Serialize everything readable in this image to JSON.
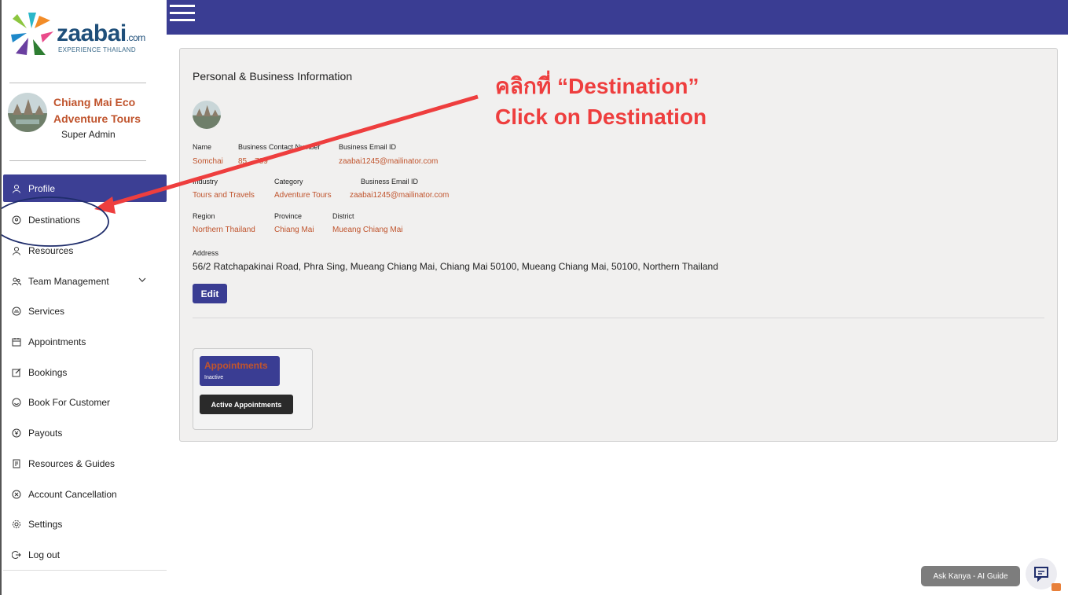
{
  "brand": {
    "name": "zaabai",
    "domain": ".com",
    "tagline": "EXPERIENCE THAILAND"
  },
  "account": {
    "business_name_line1": "Chiang Mai Eco",
    "business_name_line2": "Adventure Tours",
    "role": "Super Admin"
  },
  "sidebar": {
    "items": [
      {
        "label": "Profile",
        "icon": "user-icon"
      },
      {
        "label": "Destinations",
        "icon": "location-pin-icon"
      },
      {
        "label": "Resources",
        "icon": "user-icon"
      },
      {
        "label": "Team Management",
        "icon": "team-icon"
      },
      {
        "label": "Services",
        "icon": "services-icon"
      },
      {
        "label": "Appointments",
        "icon": "calendar-icon"
      },
      {
        "label": "Bookings",
        "icon": "edit-icon"
      },
      {
        "label": "Book For Customer",
        "icon": "smile-icon"
      },
      {
        "label": "Payouts",
        "icon": "currency-icon"
      },
      {
        "label": "Resources & Guides",
        "icon": "document-icon"
      },
      {
        "label": "Account Cancellation",
        "icon": "cancel-icon"
      },
      {
        "label": "Settings",
        "icon": "gear-icon"
      },
      {
        "label": "Log out",
        "icon": "logout-icon"
      }
    ]
  },
  "main": {
    "title": "Personal & Business Information",
    "fields": {
      "name_label": "Name",
      "name_value": "Somchai",
      "contact_label": "Business Contact Number",
      "contact_value": "85…789",
      "email_label": "Business Email ID",
      "email_value": "zaabai1245@mailinator.com",
      "industry_label": "Industry",
      "industry_value": "Tours and Travels",
      "category_label": "Category",
      "category_value": "Adventure Tours",
      "email2_label": "Business Email ID",
      "email2_value": "zaabai1245@mailinator.com",
      "region_label": "Region",
      "region_value": "Northern Thailand",
      "province_label": "Province",
      "province_value": "Chiang Mai",
      "district_label": "District",
      "district_value": "Mueang Chiang Mai",
      "address_label": "Address",
      "address_value": "56/2 Ratchapakinai Road, Phra Sing, Mueang Chiang Mai, Chiang Mai 50100, Mueang Chiang Mai, 50100, Northern Thailand"
    },
    "edit_label": "Edit",
    "appointments_card": {
      "title": "Appointments",
      "status": "Inactive",
      "button_label": "Active Appointments"
    }
  },
  "annotation": {
    "line1": "คลิกที่ “Destination”",
    "line2": "Click on Destination",
    "color": "#ee3e3e"
  },
  "chat": {
    "label": "Ask Kanya - AI Guide"
  },
  "colors": {
    "primary": "#3a3d93",
    "accent": "#c0542d"
  }
}
